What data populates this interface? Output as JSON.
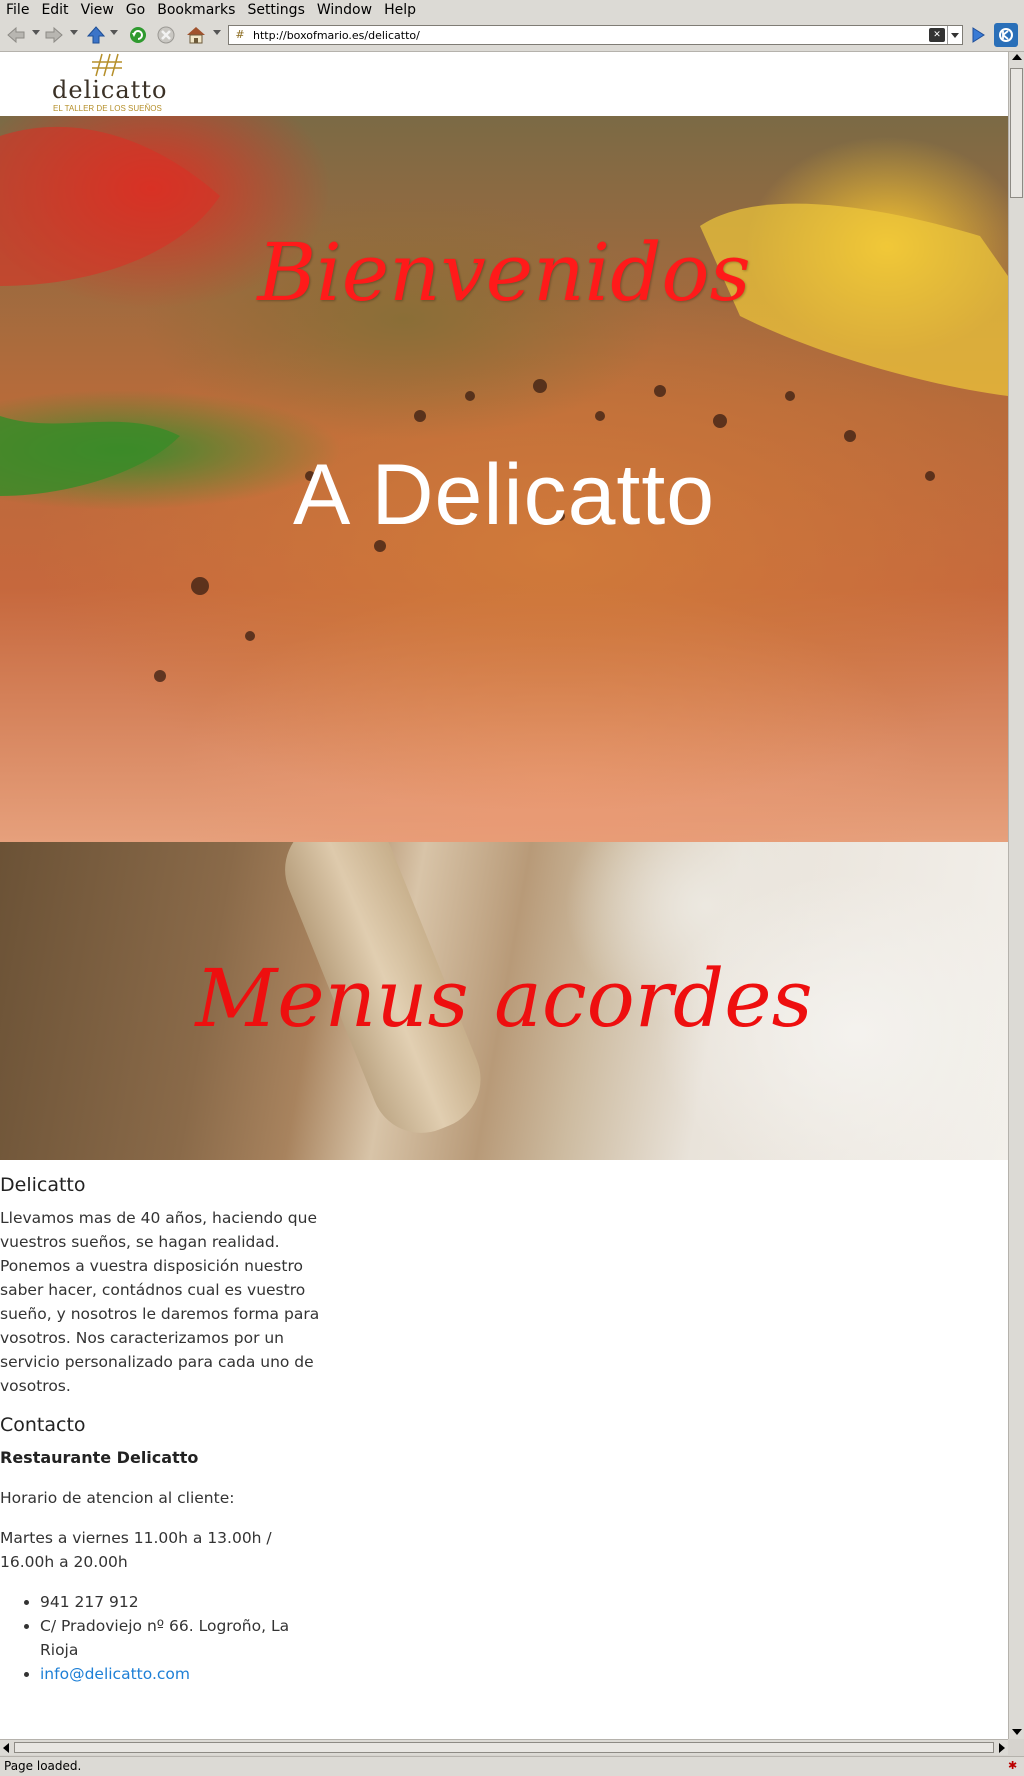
{
  "menu": [
    "File",
    "Edit",
    "View",
    "Go",
    "Bookmarks",
    "Settings",
    "Window",
    "Help"
  ],
  "url": "http://boxofmario.es/delicatto/",
  "status": "Page loaded.",
  "logo": {
    "word": "delicatto",
    "tagline": "EL TALLER DE LOS SUEÑOS"
  },
  "hero": {
    "welcome": "Bienvenidos",
    "brand": "A Delicatto"
  },
  "band": {
    "title": "Menus acordes"
  },
  "about": {
    "heading": "Delicatto",
    "text": "Llevamos mas de 40 años, haciendo que vuestros sueños, se hagan realidad. Ponemos a vuestra disposición nuestro saber hacer, contádnos cual es vuestro sueño, y nosotros le daremos forma para vosotros. Nos caracterizamos por un servicio personalizado para cada uno de vosotros."
  },
  "contact": {
    "heading": "Contacto",
    "name": "Restaurante Delicatto",
    "hours_label": "Horario de atencion al cliente:",
    "hours": "Martes a viernes 11.00h a 13.00h / 16.00h a 20.00h",
    "items": [
      "941 217 912",
      "C/ Pradoviejo nº 66. Logroño, La Rioja"
    ],
    "email": "info@delicatto.com"
  }
}
